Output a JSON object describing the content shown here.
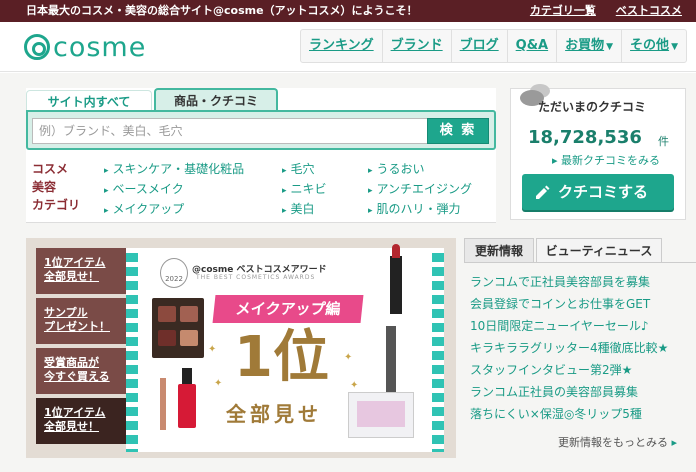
{
  "topbar": {
    "welcome": "日本最大のコスメ・美容の総合サイト@cosme（アットコスメ）にようこそ！",
    "links": [
      "カテゴリ一覧",
      "ベストコスメ"
    ]
  },
  "header": {
    "logo": "cosme",
    "nav": [
      {
        "label": "ランキング",
        "caret": false
      },
      {
        "label": "ブランド",
        "caret": false
      },
      {
        "label": "ブログ",
        "caret": false
      },
      {
        "label": "Q&A",
        "caret": false
      },
      {
        "label": "お買物",
        "caret": true
      },
      {
        "label": "その他",
        "caret": true
      }
    ]
  },
  "search": {
    "tabs": [
      "サイト内すべて",
      "商品・クチコミ"
    ],
    "active_tab": "商品・クチコミ",
    "placeholder": "例）ブランド、美白、毛穴",
    "button": "検 索",
    "category_label": [
      "コスメ",
      "美容",
      "カテゴリ"
    ],
    "categories": [
      [
        "スキンケア・基礎化粧品",
        "ベースメイク",
        "メイクアップ"
      ],
      [
        "毛穴",
        "ニキビ",
        "美白"
      ],
      [
        "うるおい",
        "アンチエイジング",
        "肌のハリ・弾力"
      ]
    ]
  },
  "kuchikomi": {
    "title": "ただいまのクチコミ",
    "count": "18,728,536",
    "unit": "件",
    "link": "最新クチコミをみる",
    "button": "クチコミする"
  },
  "banner": {
    "side_items": [
      {
        "line1": "1位アイテム",
        "line2": "全部見せ！",
        "active": false
      },
      {
        "line1": "サンプル",
        "line2": "プレゼント！",
        "active": false
      },
      {
        "line1": "受賞商品が",
        "line2": "今すぐ買える",
        "active": false
      },
      {
        "line1": "1位アイテム",
        "line2": "全部見せ！",
        "active": true
      }
    ],
    "award_brand": "@cosme ベストコスメアワード",
    "award_sub": "THE BEST COSMETICS AWARDS",
    "year": "2022",
    "tag": "メイクアップ編",
    "rank": "1位",
    "caption": "全部見せ"
  },
  "news": {
    "tabs": [
      "更新情報",
      "ビューティニュース"
    ],
    "items": [
      "ランコムで正社員美容部員を募集",
      "会員登録でコインとお仕事をGET",
      "10日間限定ニューイヤーセール♪",
      "キラキララグリッター4種徹底比較★",
      "スタッフインタビュー第2弾★",
      "ランコム正社員の美容部員募集",
      "落ちにくい×保湿◎冬リップ5種"
    ],
    "more": "更新情報をもっとみる"
  },
  "colors": {
    "brand_green": "#1ea68d",
    "topbar": "#5a1f25",
    "accent_pink": "#e84a8a",
    "gold": "#a07a38"
  }
}
